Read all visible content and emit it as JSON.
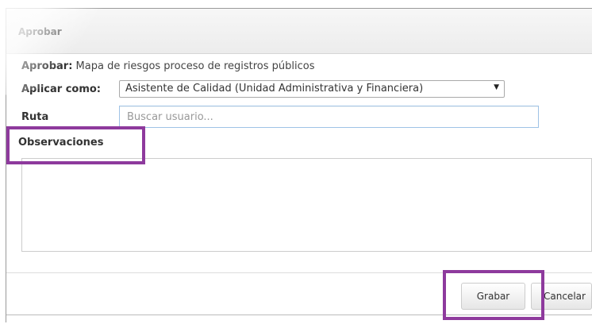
{
  "dialog": {
    "title": "Aprobar"
  },
  "approval": {
    "label": "Aprobar:",
    "value": "Mapa de riesgos proceso de registros públicos"
  },
  "apply_as": {
    "label": "Aplicar como:",
    "selected": "Asistente de Calidad (Unidad Administrativa y Financiera)"
  },
  "route": {
    "label": "Ruta",
    "placeholder": "Buscar usuario..."
  },
  "observations": {
    "label": "Observaciones",
    "value": ""
  },
  "footer": {
    "save_label": "Grabar",
    "cancel_label": "Cancelar"
  },
  "colors": {
    "highlight": "#8e3a9d",
    "input_focus_border": "#9fc3e6"
  },
  "icons": {
    "select_arrow": "dropdown-arrow-icon"
  }
}
